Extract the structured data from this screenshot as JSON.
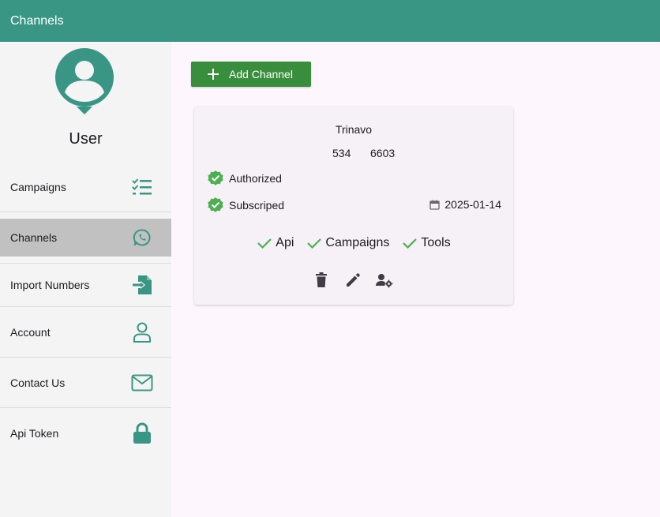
{
  "appbar": {
    "title": "Channels"
  },
  "sidebar": {
    "username": "User",
    "items": [
      {
        "label": "Campaigns",
        "icon": "checklist-icon"
      },
      {
        "label": "Channels",
        "icon": "whatsapp-icon"
      },
      {
        "label": "Import Numbers",
        "icon": "file-import-icon"
      },
      {
        "label": "Account",
        "icon": "person-icon"
      },
      {
        "label": "Contact Us",
        "icon": "envelope-icon"
      },
      {
        "label": "Api Token",
        "icon": "lock-icon"
      }
    ],
    "active_index": 1
  },
  "main": {
    "add_button_label": "Add Channel",
    "channel": {
      "name": "Trinavo",
      "number_part1": "534",
      "number_part2": "6603",
      "status1": "Authorized",
      "status2": "Subscriped",
      "date": "2025-01-14",
      "permissions": [
        "Api",
        "Campaigns",
        "Tools"
      ]
    }
  },
  "colors": {
    "primary": "#3a9684",
    "add_button": "#388e3c",
    "check_green": "#4caf50",
    "active_nav": "#c1c1c1"
  }
}
